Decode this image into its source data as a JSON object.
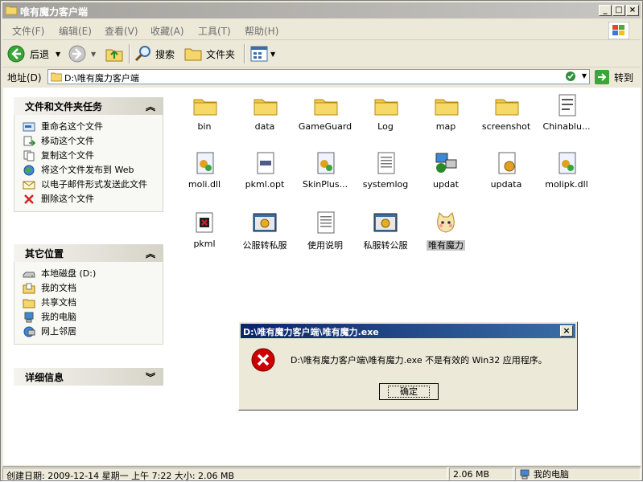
{
  "window": {
    "title": "唯有魔力客户端"
  },
  "menu": [
    "文件(F)",
    "编辑(E)",
    "查看(V)",
    "收藏(A)",
    "工具(T)",
    "帮助(H)"
  ],
  "toolbar": {
    "back": "后退",
    "search": "搜索",
    "folders": "文件夹"
  },
  "address": {
    "label": "地址(D)",
    "path": "D:\\唯有魔力客户端",
    "go": "转到"
  },
  "tasks": {
    "title": "文件和文件夹任务",
    "items": [
      "重命名这个文件",
      "移动这个文件",
      "复制这个文件",
      "将这个文件发布到 Web",
      "以电子邮件形式发送此文件",
      "删除这个文件"
    ]
  },
  "places": {
    "title": "其它位置",
    "items": [
      "本地磁盘 (D:)",
      "我的文档",
      "共享文档",
      "我的电脑",
      "网上邻居"
    ]
  },
  "details": {
    "title": "详细信息"
  },
  "files": [
    {
      "name": "bin",
      "icon": "folder-icon"
    },
    {
      "name": "data",
      "icon": "folder-icon"
    },
    {
      "name": "GameGuard",
      "icon": "folder-icon"
    },
    {
      "name": "Log",
      "icon": "folder-icon"
    },
    {
      "name": "map",
      "icon": "folder-icon"
    },
    {
      "name": "screenshot",
      "icon": "folder-icon"
    },
    {
      "name": "Chinablu...",
      "icon": "document-icon"
    },
    {
      "name": "moli.dll",
      "icon": "dll-icon"
    },
    {
      "name": "pkml.opt",
      "icon": "opt-file-icon"
    },
    {
      "name": "SkinPlus...",
      "icon": "dll-icon"
    },
    {
      "name": "systemlog",
      "icon": "text-file-icon"
    },
    {
      "name": "updat",
      "icon": "network-app-icon"
    },
    {
      "name": "updata",
      "icon": "config-file-icon"
    },
    {
      "name": "molipk.dll",
      "icon": "dll-icon"
    },
    {
      "name": "pkml",
      "icon": "exe-icon"
    },
    {
      "name": "公服转私服",
      "icon": "app-window-icon"
    },
    {
      "name": "使用说明",
      "icon": "text-file-icon"
    },
    {
      "name": "私服转公服",
      "icon": "app-window-icon"
    },
    {
      "name": "唯有魔力",
      "icon": "cat-app-icon"
    }
  ],
  "status": {
    "info": "创建日期: 2009-12-14 星期一 上午 7:22 大小: 2.06 MB",
    "size": "2.06 MB",
    "location": "我的电脑"
  },
  "dialog": {
    "title": "D:\\唯有魔力客户端\\唯有魔力.exe",
    "message": "D:\\唯有魔力客户端\\唯有魔力.exe 不是有效的 Win32 应用程序。",
    "ok": "确定"
  },
  "colors": {
    "dialog_title": "#0a246a",
    "error": "#cc0000",
    "folder": "#f2c94c"
  }
}
